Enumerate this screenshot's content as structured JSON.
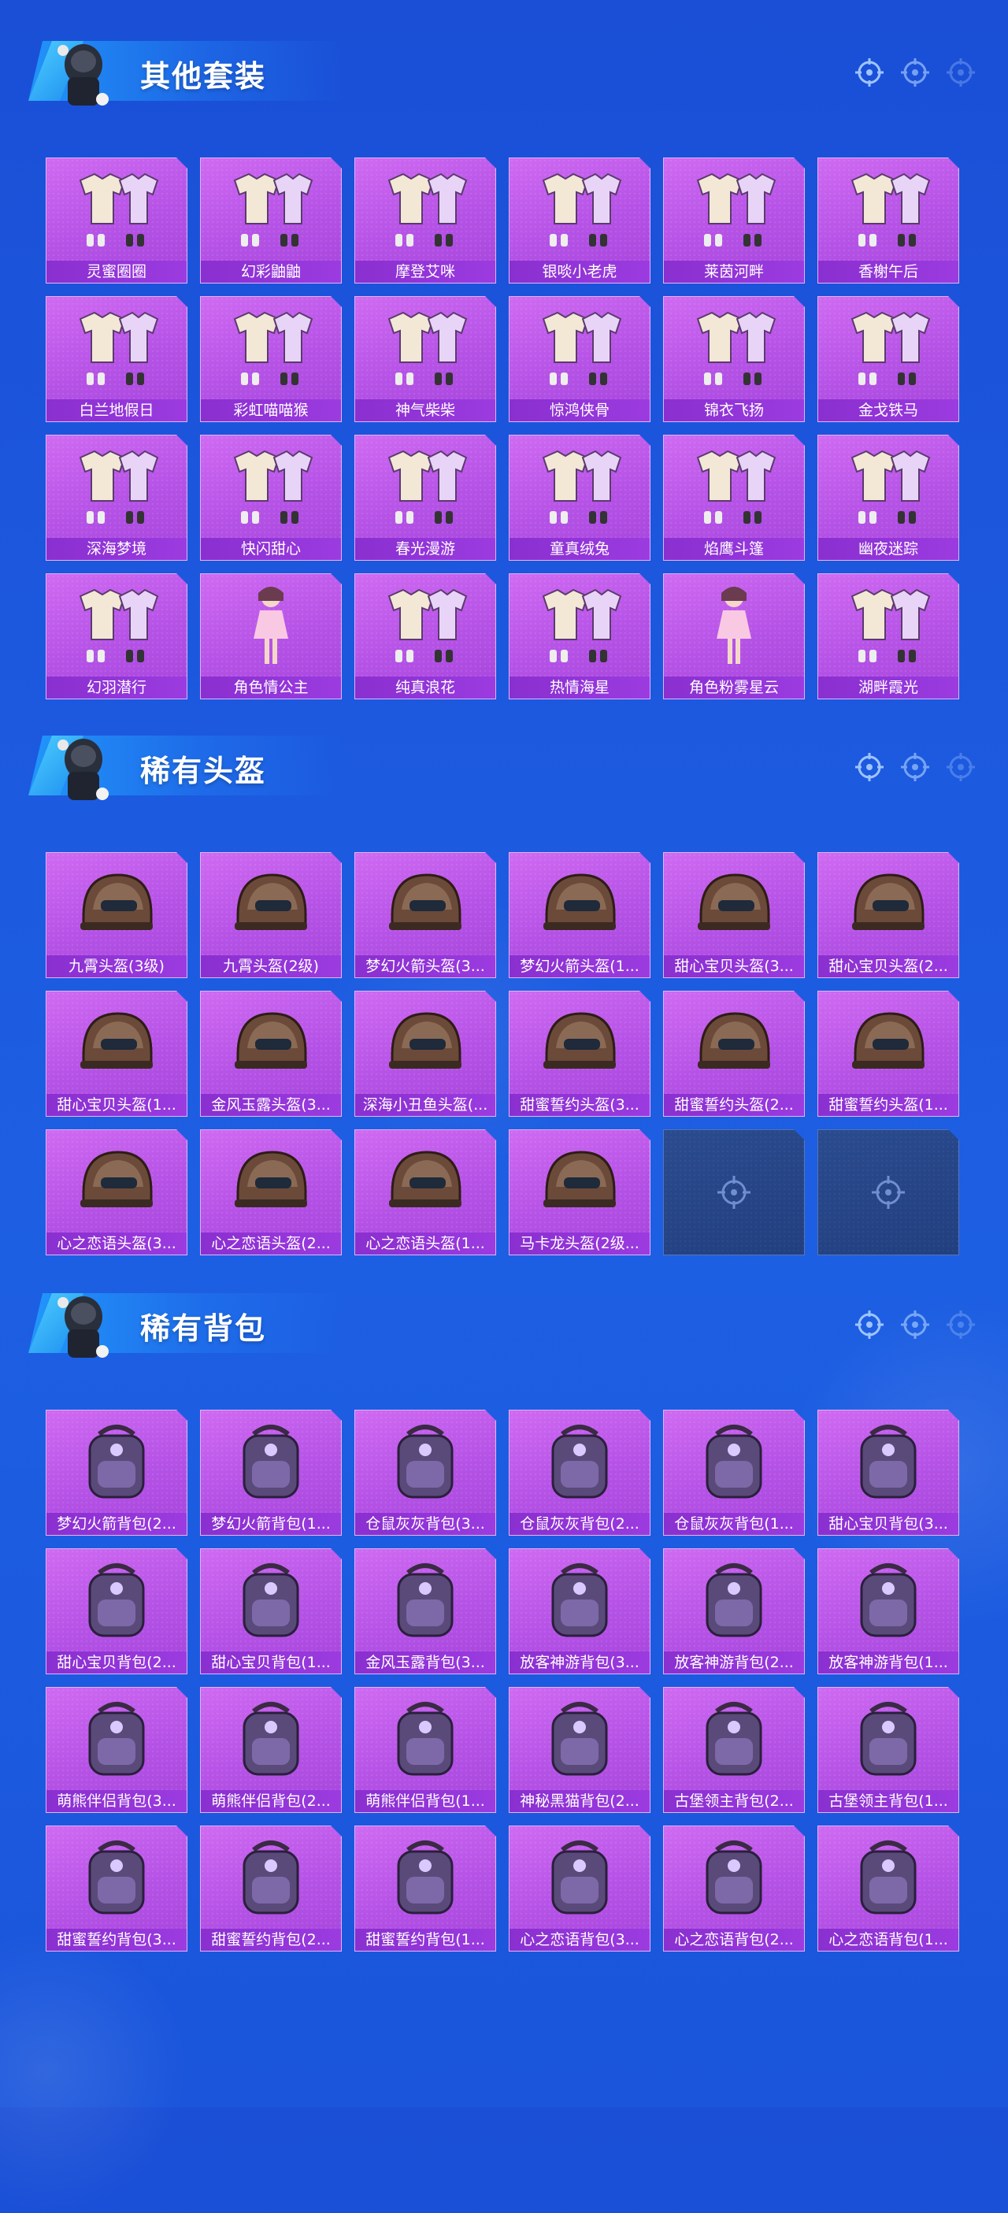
{
  "sections": [
    {
      "title": "其他套装",
      "items": [
        {
          "label": "灵蜜圈圈",
          "icon": "outfit-icon"
        },
        {
          "label": "幻彩鼬鼬",
          "icon": "outfit-icon"
        },
        {
          "label": "摩登艾咪",
          "icon": "outfit-icon"
        },
        {
          "label": "银啖小老虎",
          "icon": "outfit-icon"
        },
        {
          "label": "莱茵河畔",
          "icon": "outfit-icon"
        },
        {
          "label": "香榭午后",
          "icon": "outfit-icon"
        },
        {
          "label": "白兰地假日",
          "icon": "outfit-icon"
        },
        {
          "label": "彩虹喵喵猴",
          "icon": "outfit-icon"
        },
        {
          "label": "神气柴柴",
          "icon": "outfit-icon"
        },
        {
          "label": "惊鸿侠骨",
          "icon": "outfit-icon"
        },
        {
          "label": "锦衣飞扬",
          "icon": "outfit-icon"
        },
        {
          "label": "金戈铁马",
          "icon": "outfit-icon"
        },
        {
          "label": "深海梦境",
          "icon": "outfit-icon"
        },
        {
          "label": "快闪甜心",
          "icon": "outfit-icon"
        },
        {
          "label": "春光漫游",
          "icon": "outfit-icon"
        },
        {
          "label": "童真绒兔",
          "icon": "outfit-icon"
        },
        {
          "label": "焰鹰斗篷",
          "icon": "outfit-icon"
        },
        {
          "label": "幽夜迷踪",
          "icon": "outfit-icon"
        },
        {
          "label": "幻羽潜行",
          "icon": "outfit-icon"
        },
        {
          "label": "角色情公主",
          "icon": "character-icon"
        },
        {
          "label": "纯真浪花",
          "icon": "outfit-icon"
        },
        {
          "label": "热情海星",
          "icon": "outfit-icon"
        },
        {
          "label": "角色粉雾星云",
          "icon": "character-icon"
        },
        {
          "label": "湖畔霞光",
          "icon": "outfit-icon"
        }
      ]
    },
    {
      "title": "稀有头盔",
      "items": [
        {
          "label": "九霄头盔(3级)",
          "icon": "helmet-icon"
        },
        {
          "label": "九霄头盔(2级)",
          "icon": "helmet-icon"
        },
        {
          "label": "梦幻火箭头盔(3...",
          "icon": "helmet-icon"
        },
        {
          "label": "梦幻火箭头盔(1...",
          "icon": "helmet-icon"
        },
        {
          "label": "甜心宝贝头盔(3...",
          "icon": "helmet-icon"
        },
        {
          "label": "甜心宝贝头盔(2...",
          "icon": "helmet-icon"
        },
        {
          "label": "甜心宝贝头盔(1...",
          "icon": "helmet-icon"
        },
        {
          "label": "金风玉露头盔(3...",
          "icon": "helmet-icon"
        },
        {
          "label": "深海小丑鱼头盔(...",
          "icon": "helmet-icon"
        },
        {
          "label": "甜蜜誓约头盔(3...",
          "icon": "helmet-icon"
        },
        {
          "label": "甜蜜誓约头盔(2...",
          "icon": "helmet-icon"
        },
        {
          "label": "甜蜜誓约头盔(1...",
          "icon": "helmet-icon"
        },
        {
          "label": "心之恋语头盔(3...",
          "icon": "helmet-icon"
        },
        {
          "label": "心之恋语头盔(2...",
          "icon": "helmet-icon"
        },
        {
          "label": "心之恋语头盔(1...",
          "icon": "helmet-icon"
        },
        {
          "label": "马卡龙头盔(2级...",
          "icon": "helmet-icon"
        },
        {
          "label": "",
          "icon": "crosshair-icon",
          "empty": true
        },
        {
          "label": "",
          "icon": "crosshair-icon",
          "empty": true
        }
      ]
    },
    {
      "title": "稀有背包",
      "items": [
        {
          "label": "梦幻火箭背包(2...",
          "icon": "backpack-icon"
        },
        {
          "label": "梦幻火箭背包(1...",
          "icon": "backpack-icon"
        },
        {
          "label": "仓鼠灰灰背包(3...",
          "icon": "backpack-icon"
        },
        {
          "label": "仓鼠灰灰背包(2...",
          "icon": "backpack-icon"
        },
        {
          "label": "仓鼠灰灰背包(1...",
          "icon": "backpack-icon"
        },
        {
          "label": "甜心宝贝背包(3...",
          "icon": "backpack-icon"
        },
        {
          "label": "甜心宝贝背包(2...",
          "icon": "backpack-icon"
        },
        {
          "label": "甜心宝贝背包(1...",
          "icon": "backpack-icon"
        },
        {
          "label": "金风玉露背包(3...",
          "icon": "backpack-icon"
        },
        {
          "label": "放客神游背包(3...",
          "icon": "backpack-icon"
        },
        {
          "label": "放客神游背包(2...",
          "icon": "backpack-icon"
        },
        {
          "label": "放客神游背包(1...",
          "icon": "backpack-icon"
        },
        {
          "label": "萌熊伴侣背包(3...",
          "icon": "backpack-icon"
        },
        {
          "label": "萌熊伴侣背包(2...",
          "icon": "backpack-icon"
        },
        {
          "label": "萌熊伴侣背包(1...",
          "icon": "backpack-icon"
        },
        {
          "label": "神秘黑猫背包(2...",
          "icon": "backpack-icon"
        },
        {
          "label": "古堡领主背包(2...",
          "icon": "backpack-icon"
        },
        {
          "label": "古堡领主背包(1...",
          "icon": "backpack-icon"
        },
        {
          "label": "甜蜜誓约背包(3...",
          "icon": "backpack-icon"
        },
        {
          "label": "甜蜜誓约背包(2...",
          "icon": "backpack-icon"
        },
        {
          "label": "甜蜜誓约背包(1...",
          "icon": "backpack-icon"
        },
        {
          "label": "心之恋语背包(3...",
          "icon": "backpack-icon"
        },
        {
          "label": "心之恋语背包(2...",
          "icon": "backpack-icon"
        },
        {
          "label": "心之恋语背包(1...",
          "icon": "backpack-icon"
        }
      ]
    }
  ],
  "colors": {
    "background": "#1c58de",
    "card": "#b552e6",
    "label_bar": "#8a2fd0",
    "empty_card": "#223f7f"
  }
}
